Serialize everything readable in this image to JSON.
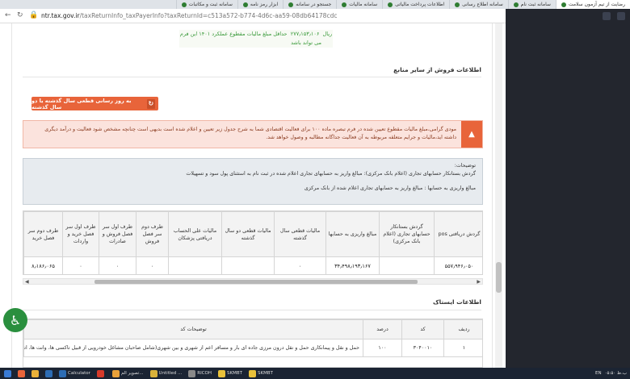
{
  "browser": {
    "tabs": [
      {
        "label": "رضایت از تیم آزمون سلامت"
      },
      {
        "label": "سامانه ثبت نام"
      },
      {
        "label": "سامانه اطلاع رسانی"
      },
      {
        "label": "اطلاعات پرداخت مالیاتی"
      },
      {
        "label": "سامانه مالیات"
      },
      {
        "label": "جستجو در سامانه"
      },
      {
        "label": "ابزار رمز نامه"
      },
      {
        "label": "سامانه ثبت و مکاتبات"
      }
    ],
    "url_host": "ntr.tax.gov.ir",
    "url_path": "/taxReturnInfo_taxPayerInfo?taxReturnId=c513a572-b774-4d6c-aa59-08db64178cdc"
  },
  "green_note": {
    "line1": "حداقل مبلغ مالیات مقطوع عملکرد ۱۴۰۱ این فرم",
    "amount": "۲۷۷٫۱۵۳٫۱۰۶",
    "currency": "ریال",
    "line2": "می تواند باشد"
  },
  "section_other": {
    "title": "اطلاعات فروش از سایر منابع"
  },
  "update_button": {
    "label": "به روز رسانی قطعی سال گذشته یا دو سال گذشته"
  },
  "warning": {
    "text": "مودی گرامی،مبلغ مالیات مقطوع تعیین شده در فرم تبصره ماده ۱۰۰ برای فعالیت اقتصادی شما به شرح جدول زیر تعیین و اعلام شده است بدیهی است چنانچه مشخص شود فعالیت و درآمد دیگری داشته اید،مالیات و جرایم متعلقه مربوطه به آن فعالیت جداگانه مطالبه و وصول خواهد شد."
  },
  "explanations": {
    "label": "توضیحات:",
    "line1": "گردش بستانکار حسابهای تجاری (اعلام بانک مرکزی): مبالغ واریز به حسابهای تجاری اعلام شده در ثبت نام به استثنای پول سود و تسهیلات",
    "line2": "مبالغ واریزی به حسابها : مبالغ واریز به حسابهای تجاری اعلام شده از بانک مرکزی"
  },
  "sales_table": {
    "headers": [
      "گردش دریافتی pos",
      "گردش بستانکار حسابهای تجاری (اعلام بانک مرکزی)",
      "مبالغ واریزی به حسابها",
      "مالیات قطعی سال گذشته",
      "مالیات قطعی دو سال گذشته",
      "مالیات علی الحساب دریافتی پزشکان",
      "طرف دوم سر فصل فروش",
      "طرف اول سر فصل فروش و صادرات",
      "طرف اول سر فصل خرید و واردات",
      "طرف دوم سر فصل خرید"
    ],
    "row": [
      "۵۵۷٫۹۴۶٫۰۵۰",
      "",
      "۳۴٫۴۹۸٫۱۹۳٫۱۶۷",
      "۰",
      "",
      "",
      "۰",
      "۰",
      "۰",
      "۸٫۱۸۶٫۰۶۵"
    ]
  },
  "section_activity": {
    "title": "اطلاعات ایستاک"
  },
  "activity_table": {
    "headers": [
      "ردیف",
      "کد",
      "درصد",
      "توضیحات کد"
    ],
    "row": [
      "۱",
      "۳۰۴۰۰۱۰",
      "۱۰۰",
      "حمل و نقل و پیمانکاری حمل و نقل درون مرزی جاده ای بار و مسافر اعم از شهری و بین شهری(شامل صاحبان مشاغل خودرویی از قبیل تاکسی ها، وانت ها، اتوبوس ها و"
    ]
  },
  "taskbar": {
    "items": [
      {
        "label": "Calculator",
        "color": "#2d6db5"
      },
      {
        "label": "",
        "color": "#d63a2a"
      },
      {
        "label": "تصویر الم...",
        "color": "#e9a13a"
      },
      {
        "label": "Untitled ...",
        "color": "#d9b23a"
      },
      {
        "label": "RICOH",
        "color": "#8a8a8a"
      },
      {
        "label": "SKMBT",
        "color": "#e9c13a"
      },
      {
        "label": "SKMBT",
        "color": "#e9c13a"
      }
    ],
    "lang": "EN",
    "time": "۰۵:۵۰ ب.ظ"
  },
  "colors": {
    "accent_orange": "#e8643a",
    "green_text": "#3a9a3a",
    "accessibility_green": "#2a8f3e",
    "dark_panel": "#23262e",
    "taskbar": "#1b2433"
  }
}
